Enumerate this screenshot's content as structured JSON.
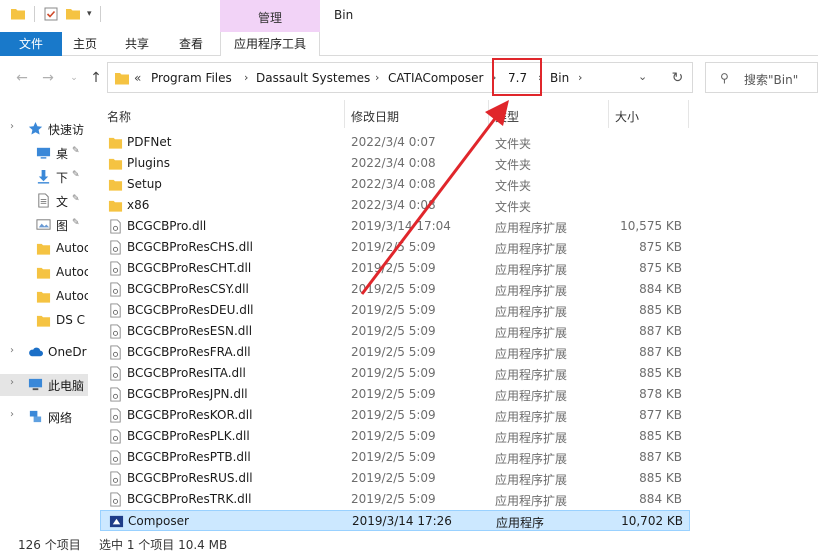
{
  "titlebar": {
    "tool_group_label": "管理",
    "window_title": "Bin"
  },
  "ribbon": {
    "tabs": [
      "文件",
      "主页",
      "共享",
      "查看",
      "应用程序工具"
    ]
  },
  "address": {
    "crumbs": [
      "Program Files",
      "Dassault Systemes",
      "CATIAComposer",
      "7.7",
      "Bin"
    ],
    "overflow": "«"
  },
  "search": {
    "placeholder": "搜索\"Bin\""
  },
  "sidebar": {
    "items": [
      {
        "label": "快速访",
        "icon": "star-icon"
      },
      {
        "label": "桌",
        "icon": "desktop-icon"
      },
      {
        "label": "下",
        "icon": "download-icon"
      },
      {
        "label": "文",
        "icon": "document-icon"
      },
      {
        "label": "图",
        "icon": "picture-icon"
      },
      {
        "label": "Autoc",
        "icon": "folder-icon"
      },
      {
        "label": "Autoc",
        "icon": "folder-icon"
      },
      {
        "label": "Autoc",
        "icon": "folder-icon"
      },
      {
        "label": "DS C",
        "icon": "folder-icon"
      },
      {
        "label": "OneDr",
        "icon": "cloud-icon"
      },
      {
        "label": "此电脑",
        "icon": "computer-icon"
      },
      {
        "label": "网络",
        "icon": "network-icon"
      }
    ]
  },
  "columns": {
    "name": "名称",
    "date": "修改日期",
    "type": "类型",
    "size": "大小"
  },
  "files": [
    {
      "name": "PDFNet",
      "date": "2022/3/4 0:07",
      "type": "文件夹",
      "size": "",
      "kind": "folder"
    },
    {
      "name": "Plugins",
      "date": "2022/3/4 0:08",
      "type": "文件夹",
      "size": "",
      "kind": "folder"
    },
    {
      "name": "Setup",
      "date": "2022/3/4 0:08",
      "type": "文件夹",
      "size": "",
      "kind": "folder"
    },
    {
      "name": "x86",
      "date": "2022/3/4 0:08",
      "type": "文件夹",
      "size": "",
      "kind": "folder"
    },
    {
      "name": "BCGCBPro.dll",
      "date": "2019/3/14 17:04",
      "type": "应用程序扩展",
      "size": "10,575 KB",
      "kind": "dll"
    },
    {
      "name": "BCGCBProResCHS.dll",
      "date": "2019/2/5 5:09",
      "type": "应用程序扩展",
      "size": "875 KB",
      "kind": "dll"
    },
    {
      "name": "BCGCBProResCHT.dll",
      "date": "2019/2/5 5:09",
      "type": "应用程序扩展",
      "size": "875 KB",
      "kind": "dll"
    },
    {
      "name": "BCGCBProResCSY.dll",
      "date": "2019/2/5 5:09",
      "type": "应用程序扩展",
      "size": "884 KB",
      "kind": "dll"
    },
    {
      "name": "BCGCBProResDEU.dll",
      "date": "2019/2/5 5:09",
      "type": "应用程序扩展",
      "size": "885 KB",
      "kind": "dll"
    },
    {
      "name": "BCGCBProResESN.dll",
      "date": "2019/2/5 5:09",
      "type": "应用程序扩展",
      "size": "887 KB",
      "kind": "dll"
    },
    {
      "name": "BCGCBProResFRA.dll",
      "date": "2019/2/5 5:09",
      "type": "应用程序扩展",
      "size": "887 KB",
      "kind": "dll"
    },
    {
      "name": "BCGCBProResITA.dll",
      "date": "2019/2/5 5:09",
      "type": "应用程序扩展",
      "size": "885 KB",
      "kind": "dll"
    },
    {
      "name": "BCGCBProResJPN.dll",
      "date": "2019/2/5 5:09",
      "type": "应用程序扩展",
      "size": "878 KB",
      "kind": "dll"
    },
    {
      "name": "BCGCBProResKOR.dll",
      "date": "2019/2/5 5:09",
      "type": "应用程序扩展",
      "size": "877 KB",
      "kind": "dll"
    },
    {
      "name": "BCGCBProResPLK.dll",
      "date": "2019/2/5 5:09",
      "type": "应用程序扩展",
      "size": "885 KB",
      "kind": "dll"
    },
    {
      "name": "BCGCBProResPTB.dll",
      "date": "2019/2/5 5:09",
      "type": "应用程序扩展",
      "size": "887 KB",
      "kind": "dll"
    },
    {
      "name": "BCGCBProResRUS.dll",
      "date": "2019/2/5 5:09",
      "type": "应用程序扩展",
      "size": "885 KB",
      "kind": "dll"
    },
    {
      "name": "BCGCBProResTRK.dll",
      "date": "2019/2/5 5:09",
      "type": "应用程序扩展",
      "size": "884 KB",
      "kind": "dll"
    },
    {
      "name": "Composer",
      "date": "2019/3/14 17:26",
      "type": "应用程序",
      "size": "10,702 KB",
      "kind": "exe",
      "selected": true
    }
  ],
  "status": {
    "count": "126 个项目",
    "selection": "选中 1 个项目  10.4 MB"
  },
  "colors": {
    "accent": "#1979ca",
    "tool_tab": "#f2d3f7",
    "selection": "#cce8ff",
    "annotation": "#e0262b",
    "folder": "#f5c342"
  }
}
